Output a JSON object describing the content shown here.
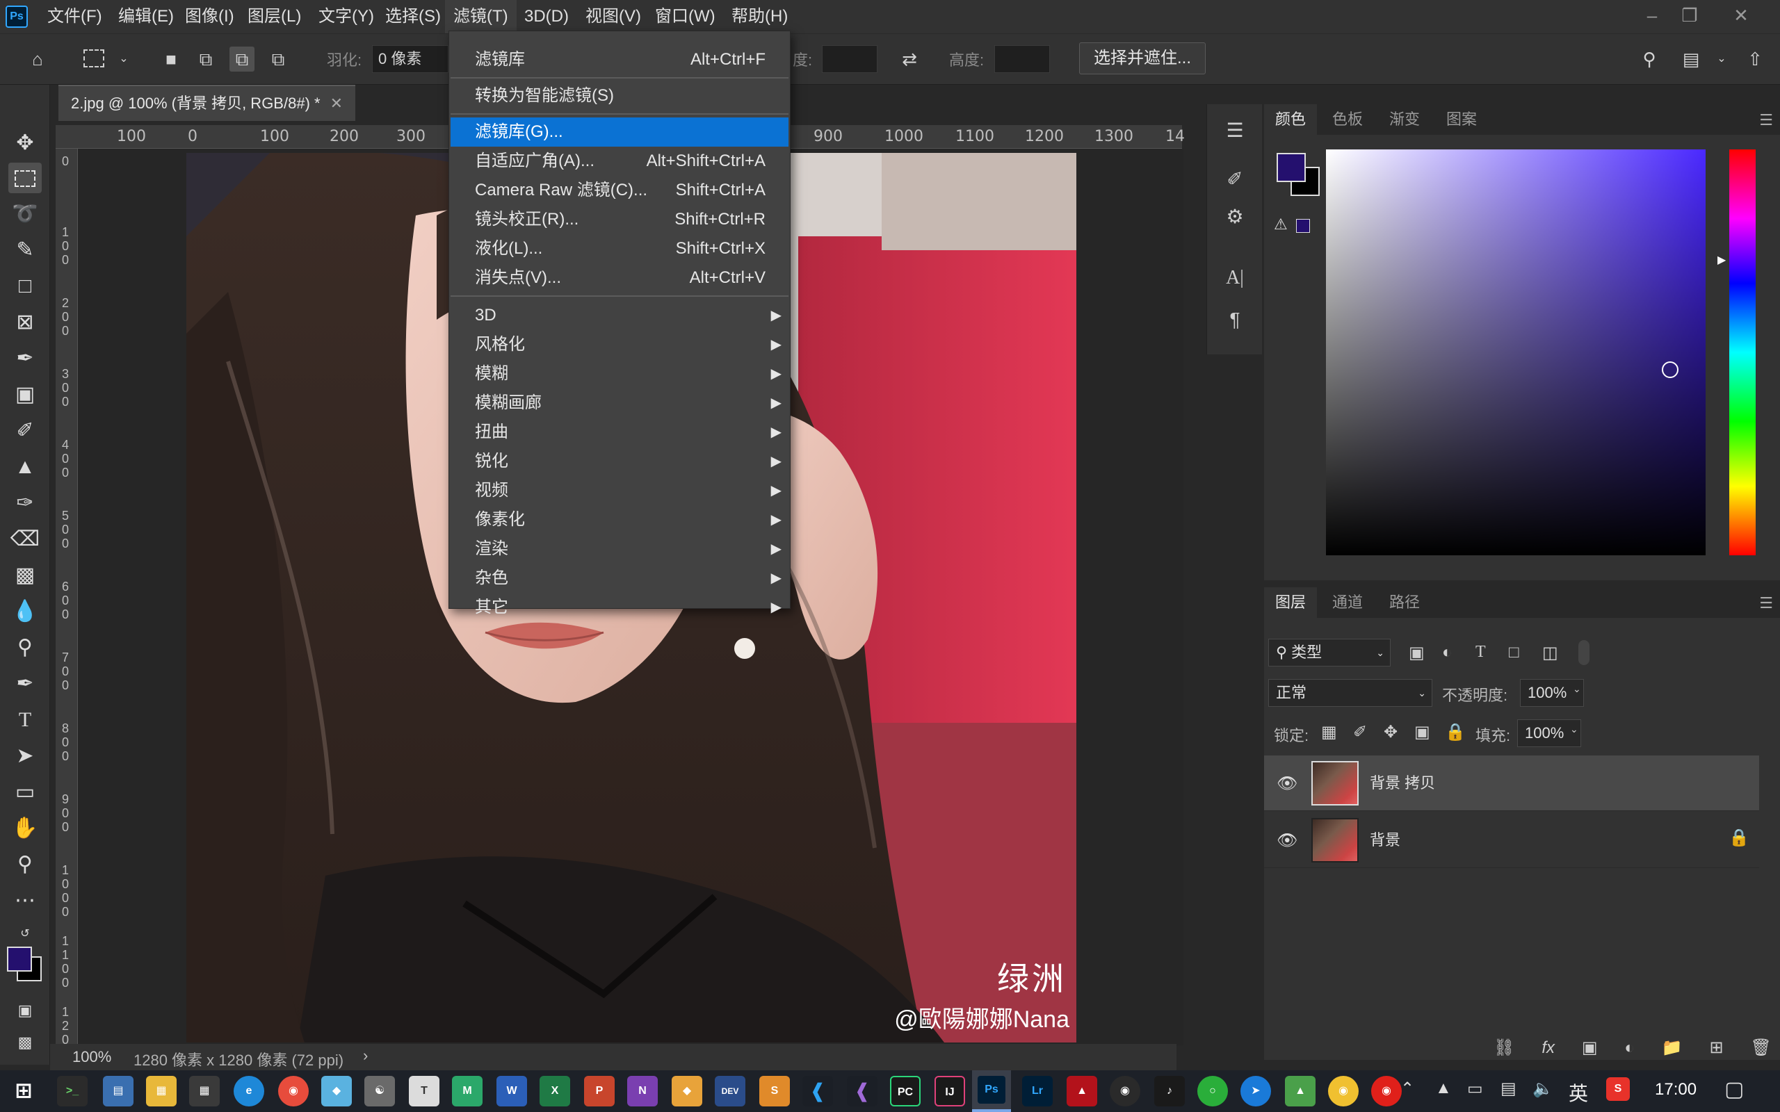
{
  "menubar": {
    "logo": "Ps",
    "items": [
      "文件(F)",
      "编辑(E)",
      "图像(I)",
      "图层(L)",
      "文字(Y)",
      "选择(S)",
      "滤镜(T)",
      "3D(D)",
      "视图(V)",
      "窗口(W)",
      "帮助(H)"
    ],
    "active_item": "滤镜(T)"
  },
  "window_controls": [
    "minimize",
    "restore",
    "close"
  ],
  "options_bar": {
    "feather_label": "羽化:",
    "feather_value": "0 像素",
    "width_label": "度:",
    "height_label": "高度:",
    "select_mask_button": "选择并遮住..."
  },
  "document": {
    "tab_title": "2.jpg @ 100% (背景 拷贝, RGB/8#) *",
    "ruler_h": [
      "100",
      "0",
      "100",
      "200",
      "300",
      "900",
      "1000",
      "1100",
      "1200",
      "1300",
      "14"
    ],
    "ruler_v": [
      "0",
      "1\n0\n0",
      "2\n0\n0",
      "3\n0\n0",
      "4\n0\n0",
      "5\n0\n0",
      "6\n0\n0",
      "7\n0\n0",
      "8\n0\n0",
      "9\n0\n0",
      "1\n0\n0\n0",
      "1\n1\n0\n0",
      "1\n2\n0\n0"
    ],
    "zoom": "100%",
    "doc_info": "1280 像素 x 1280 像素 (72 ppi)",
    "watermark_brand": "绿洲",
    "watermark_user": "@歐陽娜娜Nana"
  },
  "filter_menu": {
    "items": [
      {
        "label": "滤镜库",
        "shortcut": "Alt+Ctrl+F"
      },
      {
        "label": "转换为智能滤镜(S)",
        "shortcut": ""
      },
      {
        "label": "滤镜库(G)...",
        "shortcut": "",
        "highlighted": true
      },
      {
        "label": "自适应广角(A)...",
        "shortcut": "Alt+Shift+Ctrl+A"
      },
      {
        "label": "Camera Raw 滤镜(C)...",
        "shortcut": "Shift+Ctrl+A"
      },
      {
        "label": "镜头校正(R)...",
        "shortcut": "Shift+Ctrl+R"
      },
      {
        "label": "液化(L)...",
        "shortcut": "Shift+Ctrl+X"
      },
      {
        "label": "消失点(V)...",
        "shortcut": "Alt+Ctrl+V"
      },
      {
        "label": "3D",
        "submenu": true
      },
      {
        "label": "风格化",
        "submenu": true
      },
      {
        "label": "模糊",
        "submenu": true
      },
      {
        "label": "模糊画廊",
        "submenu": true
      },
      {
        "label": "扭曲",
        "submenu": true
      },
      {
        "label": "锐化",
        "submenu": true
      },
      {
        "label": "视频",
        "submenu": true
      },
      {
        "label": "像素化",
        "submenu": true
      },
      {
        "label": "渲染",
        "submenu": true
      },
      {
        "label": "杂色",
        "submenu": true
      },
      {
        "label": "其它",
        "submenu": true
      }
    ]
  },
  "color_panel": {
    "tabs": [
      "颜色",
      "色板",
      "渐变",
      "图案"
    ],
    "foreground": "#24106e",
    "background": "#000000"
  },
  "layers_panel": {
    "tabs": [
      "图层",
      "通道",
      "路径"
    ],
    "filter_kind": "类型",
    "blend_mode": "正常",
    "opacity_label": "不透明度:",
    "opacity_value": "100%",
    "lock_label": "锁定:",
    "fill_label": "填充:",
    "fill_value": "100%",
    "layers": [
      {
        "name": "背景 拷贝",
        "selected": true,
        "locked": false
      },
      {
        "name": "背景",
        "selected": false,
        "locked": true
      }
    ],
    "footer_icons": [
      "link-icon",
      "fx-icon",
      "mask-icon",
      "adjustment-icon",
      "group-icon",
      "new-layer-icon",
      "delete-icon"
    ]
  },
  "taskbar": {
    "time": "17:00",
    "ime": "英"
  },
  "colors": {
    "accent": "#0b72d3",
    "panel_bg": "#323232",
    "app_bg": "#282828"
  }
}
